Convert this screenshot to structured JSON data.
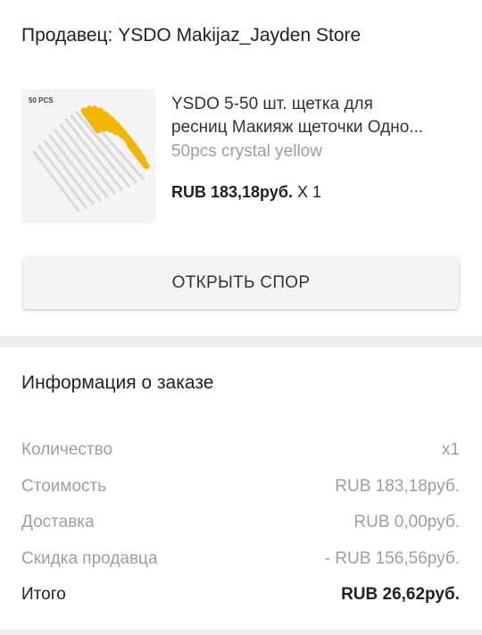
{
  "seller": {
    "label": "Продавец: YSDO Makijaz_Jayden Store"
  },
  "product": {
    "image_caption": "50 PCS",
    "title_line1": "YSDO 5-50 шт. щетка для",
    "title_line2": "ресниц Макияж щеточки Одно...",
    "variant": "50pcs crystal yellow",
    "price": "RUB 183,18руб.",
    "quantity": "X 1",
    "brush_color": "#f2b705"
  },
  "dispute_button": {
    "label": "ОТКРЫТЬ СПОР"
  },
  "order_info": {
    "title": "Информация о заказе",
    "rows": [
      {
        "label": "Количество",
        "value": "x1"
      },
      {
        "label": "Стоимость",
        "value": "RUB 183,18руб."
      },
      {
        "label": "Доставка",
        "value": "RUB 0,00руб."
      },
      {
        "label": "Скидка продавца",
        "value": "- RUB 156,56руб."
      }
    ],
    "total": {
      "label": "Итого",
      "value": "RUB 26,62руб."
    }
  }
}
